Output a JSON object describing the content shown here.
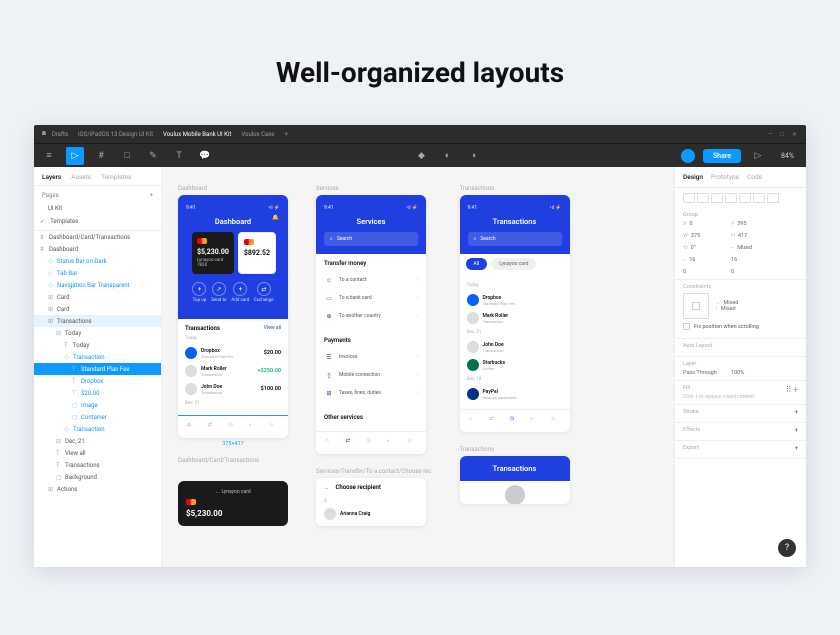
{
  "hero": "Well-organized layouts",
  "titlebar": {
    "items": [
      "Drafts",
      "iOS/iPadOS 13 Design UI Kit",
      "Voulux Mobile Bank UI Kit",
      "Voulux Case"
    ],
    "active_index": 2
  },
  "toolbar": {
    "share": "Share",
    "zoom": "84%"
  },
  "left": {
    "tabs": [
      "Layers",
      "Assets",
      "Templates"
    ],
    "pages_label": "Pages",
    "pages": [
      "UI Kit",
      "Templates"
    ],
    "layers": [
      {
        "t": "Dashboard/Card/Transactions",
        "i": 0,
        "ic": "#"
      },
      {
        "t": "Dashboard",
        "i": 0,
        "ic": "#"
      },
      {
        "t": "Status Bar on Dark",
        "i": 1,
        "blue": true,
        "ic": "◇"
      },
      {
        "t": "Tab Bar",
        "i": 1,
        "blue": true,
        "ic": "◇"
      },
      {
        "t": "Navigation Bar Transparent",
        "i": 1,
        "blue": true,
        "ic": "◇"
      },
      {
        "t": "Card",
        "i": 1,
        "ic": "⊞"
      },
      {
        "t": "Card",
        "i": 1,
        "ic": "⊞"
      },
      {
        "t": "Transactions",
        "i": 1,
        "sel": true,
        "ic": "⊞"
      },
      {
        "t": "Today",
        "i": 2,
        "ic": "⊟"
      },
      {
        "t": "Today",
        "i": 3,
        "ic": "T"
      },
      {
        "t": "Transaction",
        "i": 3,
        "blue": true,
        "ic": "◇"
      },
      {
        "t": "Standard Plan Fee",
        "i": 4,
        "selb": true,
        "ic": "T"
      },
      {
        "t": "Dropbox",
        "i": 4,
        "blue": true,
        "ic": "T"
      },
      {
        "t": "$20.00",
        "i": 4,
        "blue": true,
        "ic": "T"
      },
      {
        "t": "Image",
        "i": 4,
        "blue": true,
        "ic": "▢"
      },
      {
        "t": "Container",
        "i": 4,
        "blue": true,
        "ic": "▢"
      },
      {
        "t": "Transaction",
        "i": 3,
        "blue": true,
        "ic": "◇"
      },
      {
        "t": "Dec, 21",
        "i": 2,
        "ic": "⊟"
      },
      {
        "t": "View all",
        "i": 2,
        "ic": "T"
      },
      {
        "t": "Transactions",
        "i": 2,
        "ic": "T"
      },
      {
        "t": "Background",
        "i": 2,
        "ic": "▢"
      },
      {
        "t": "Actions",
        "i": 1,
        "ic": "⊞"
      }
    ]
  },
  "frames": {
    "f1": {
      "label": "Dashboard",
      "time": "9:41",
      "title": "Dashboard",
      "card1_amount": "$5,230.00",
      "card1_sub": "Lynayoo card",
      "card1_num": "7830",
      "card2_amount": "$892.52",
      "card2_sub": "",
      "actions": [
        "Top up",
        "Send to",
        "Add card",
        "Exchange"
      ],
      "txns_title": "Transactions",
      "view_all": "View all",
      "today": "Today",
      "rows": [
        {
          "n": "Dropbox",
          "s": "Standard Plan Fee",
          "a": "$20.00",
          "av": "db"
        },
        {
          "n": "Mark Roller",
          "s": "Transaction",
          "a": "+$250.00",
          "pos": true,
          "av": ""
        },
        {
          "n": "John Doe",
          "s": "Transaction",
          "a": "$100.00",
          "av": ""
        }
      ],
      "dec": "Dec, 21",
      "dim": "375×417"
    },
    "f2": {
      "label": "Services",
      "time": "9:41",
      "title": "Services",
      "search": "Search",
      "s1": "Transfer money",
      "s1r": [
        "To a contact",
        "To a bank card",
        "To another country"
      ],
      "s2": "Payments",
      "s2r": [
        "Invoices",
        "Mobile connection",
        "Taxes, fines, duties"
      ],
      "s3": "Other services"
    },
    "f3": {
      "label": "Transactions",
      "title": "Transactions",
      "search": "Search",
      "chips": [
        "All",
        "Lynayoo card"
      ],
      "today": "Today",
      "rows": [
        {
          "n": "Dropbox",
          "s": "Standard Plan Fee",
          "av": "db"
        },
        {
          "n": "Mark Roller",
          "s": "Transaction",
          "av": ""
        }
      ],
      "dec": "Dec, 21",
      "rows2": [
        {
          "n": "John Doe",
          "s": "Transaction",
          "av": ""
        },
        {
          "n": "Starbucks",
          "s": "Coffee",
          "av": "sb"
        }
      ],
      "dec2": "Dec, 18",
      "rows3": [
        {
          "n": "PayPal",
          "s": "Balance repayment",
          "av": "pp"
        }
      ]
    },
    "f4": {
      "label": "Dashboard/Card/Transactions",
      "sub": "Lynayoo card",
      "amount": "$5,230.00"
    },
    "f5": {
      "label": "Services/Transfer/To a contact/Choose rec",
      "title": "Choose recipient",
      "row": "Arianna Craig"
    },
    "f6": {
      "label": "Transactions",
      "title": "Transactions"
    }
  },
  "right": {
    "tabs": [
      "Design",
      "Prototype",
      "Code"
    ],
    "group": "Group",
    "x": "0",
    "y": "395",
    "w": "375",
    "h": "417",
    "rot": "0°",
    "rad": "Mixed",
    "a1": "16",
    "a2": "16",
    "a3": "0",
    "a4": "0",
    "constraints": "Constraints",
    "c_h": "Mixed",
    "c_v": "Mixed",
    "fix": "Fix position when scrolling",
    "auto": "Auto Layout",
    "layer": "Layer",
    "pass": "Pass Through",
    "pct": "100%",
    "fill": "Fill",
    "fill_hint": "Click + to replace mixed content.",
    "stroke": "Stroke",
    "effects": "Effects",
    "export": "Export"
  }
}
